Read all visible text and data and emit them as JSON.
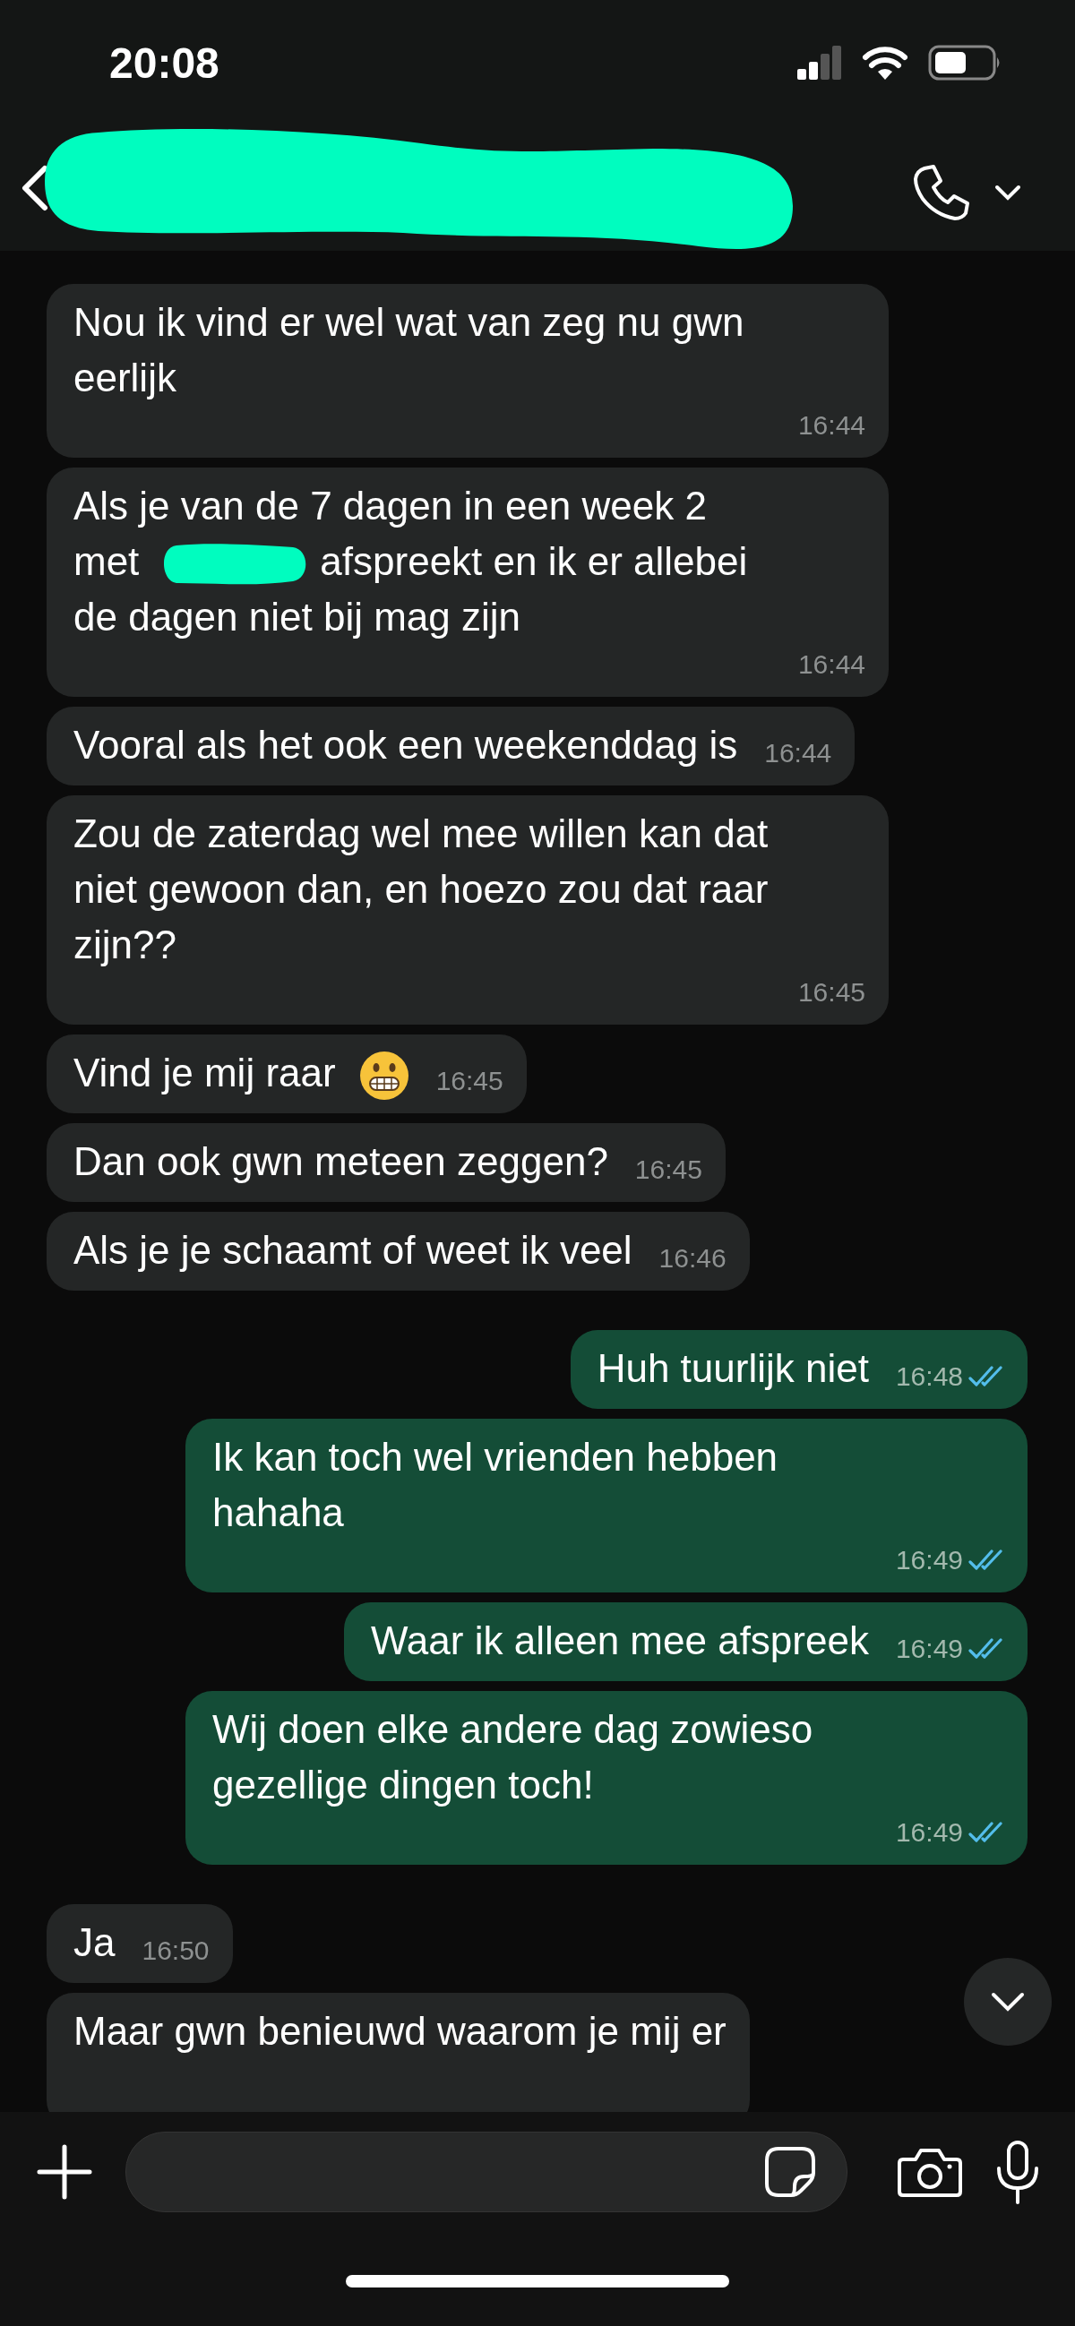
{
  "status_bar": {
    "time": "20:08"
  },
  "header": {
    "title_redacted": true
  },
  "messages": [
    {
      "outgoing": false,
      "segments": [
        {
          "kind": "text",
          "text": "Nou ik vind er wel wat van zeg nu gwn eerlijk"
        }
      ],
      "time": "16:44"
    },
    {
      "outgoing": false,
      "segments": [
        {
          "kind": "text",
          "text": "Als je van de 7 dagen in een week 2"
        },
        {
          "kind": "text",
          "text": "met"
        },
        {
          "kind": "redaction"
        },
        {
          "kind": "text",
          "text": "afspreekt en ik er allebei"
        },
        {
          "kind": "text",
          "text": "de dagen niet bij mag zijn"
        }
      ],
      "time": "16:44"
    },
    {
      "outgoing": false,
      "segments": [
        {
          "kind": "text",
          "text": "Vooral als het ook een weekenddag is"
        }
      ],
      "time": "16:44"
    },
    {
      "outgoing": false,
      "segments": [
        {
          "kind": "text",
          "text": "Zou de zaterdag wel mee willen kan dat niet gewoon dan, en hoezo zou dat raar zijn??"
        }
      ],
      "time": "16:45"
    },
    {
      "outgoing": false,
      "segments": [
        {
          "kind": "text",
          "text": "Vind je mij raar"
        },
        {
          "kind": "emoji"
        }
      ],
      "time": "16:45"
    },
    {
      "outgoing": false,
      "segments": [
        {
          "kind": "text",
          "text": "Dan ook gwn meteen zeggen?"
        }
      ],
      "time": "16:45"
    },
    {
      "outgoing": false,
      "segments": [
        {
          "kind": "text",
          "text": "Als je je schaamt of weet ik veel"
        }
      ],
      "time": "16:46"
    },
    {
      "outgoing": true,
      "segments": [
        {
          "kind": "text",
          "text": "Huh tuurlijk niet"
        }
      ],
      "time": "16:48",
      "read": true
    },
    {
      "outgoing": true,
      "segments": [
        {
          "kind": "text",
          "text": "Ik kan toch wel vrienden hebben hahaha"
        }
      ],
      "time": "16:49",
      "read": true
    },
    {
      "outgoing": true,
      "segments": [
        {
          "kind": "text",
          "text": "Waar ik alleen mee afspreek"
        }
      ],
      "time": "16:49",
      "read": true
    },
    {
      "outgoing": true,
      "segments": [
        {
          "kind": "text",
          "text": "Wij doen elke andere dag zowieso gezellige dingen toch!"
        }
      ],
      "time": "16:49",
      "read": true
    },
    {
      "outgoing": false,
      "segments": [
        {
          "kind": "text",
          "text": "Ja"
        }
      ],
      "time": "16:50"
    },
    {
      "outgoing": false,
      "segments": [
        {
          "kind": "text",
          "text": "Maar gwn benieuwd waarom je mij er"
        }
      ]
    }
  ]
}
